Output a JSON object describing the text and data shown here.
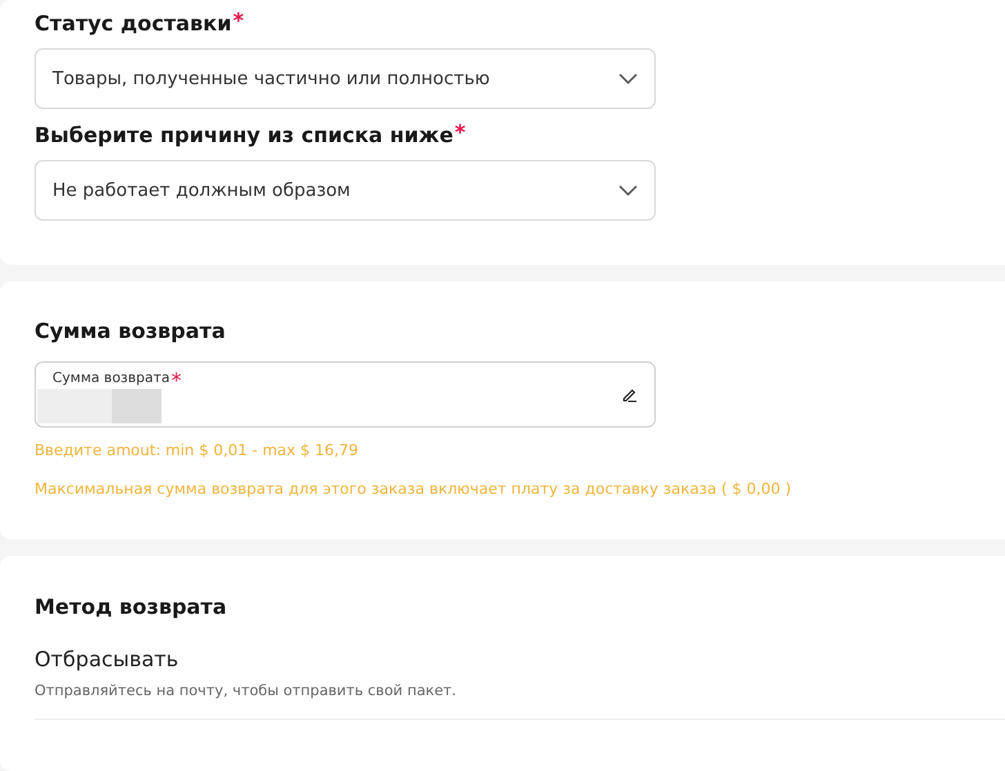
{
  "delivery_status": {
    "label": "Статус доставки",
    "required_mark": "*",
    "value": "Товары, полученные частично или полностью"
  },
  "reason": {
    "label": "Выберите причину из списка ниже",
    "required_mark": "*",
    "value": "Не работает должным образом"
  },
  "refund_amount": {
    "title": "Сумма возврата",
    "field_label": "Сумма возврата",
    "required_mark": "*",
    "hint": "Введите amout: min $ 0,01 - max $ 16,79",
    "note": "Максимальная сумма возврата для этого заказа включает плату за доставку заказа ( $ 0,00 )"
  },
  "return_method": {
    "title": "Метод возврата",
    "option_title": "Отбрасывать",
    "option_description": "Отправляйтесь на почту, чтобы отправить свой пакет."
  }
}
